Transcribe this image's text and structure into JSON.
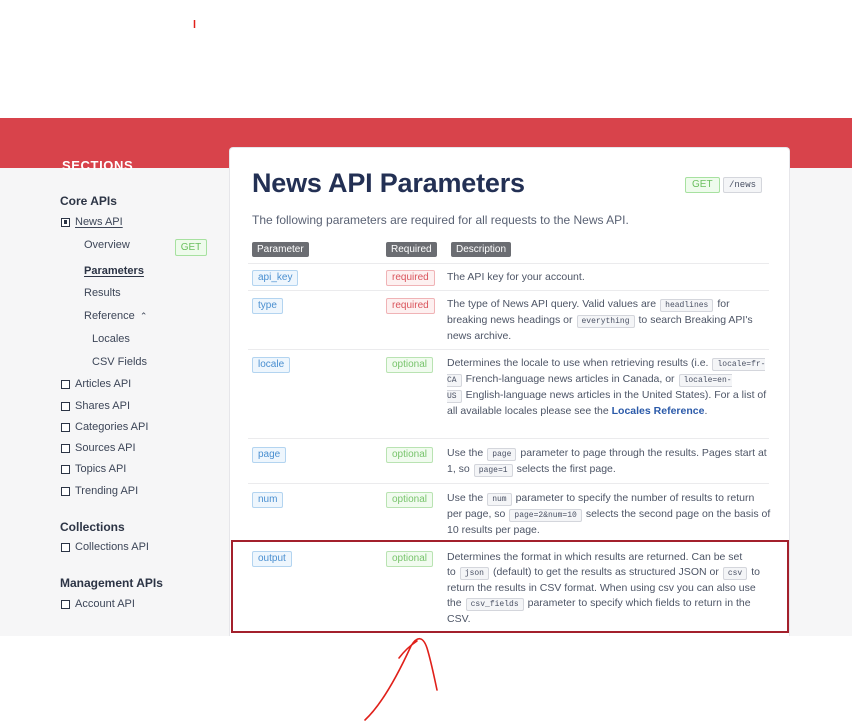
{
  "sidebar": {
    "title": "SECTIONS",
    "groups": {
      "core": {
        "title": "Core APIs",
        "items": [
          "News API",
          "Articles API",
          "Shares API",
          "Categories API",
          "Sources API",
          "Topics API",
          "Trending API"
        ]
      },
      "news_sub": {
        "overview": "Overview",
        "overview_method": "GET",
        "parameters": "Parameters",
        "results": "Results",
        "reference": "Reference",
        "locales": "Locales",
        "csv_fields": "CSV Fields"
      },
      "collections": {
        "title": "Collections",
        "items": [
          "Collections API"
        ]
      },
      "management": {
        "title": "Management APIs",
        "items": [
          "Account API"
        ]
      }
    }
  },
  "main": {
    "title": "News API Parameters",
    "method": "GET",
    "path": "/news",
    "subtitle": "The following parameters are required for all requests to the News API.",
    "headers": [
      "Parameter",
      "Required",
      "Description"
    ],
    "rows": [
      {
        "name": "api_key",
        "req": "required",
        "desc": [
          "The API key for your account."
        ]
      },
      {
        "name": "type",
        "req": "required",
        "desc": [
          "The type of News API query. Valid values are",
          "headlines",
          "for breaking news headings or",
          "everything",
          "to search Breaking API's news archive."
        ]
      },
      {
        "name": "locale",
        "req": "optional",
        "desc": [
          "Determines the locale to use when retrieving results (i.e.",
          "locale=fr-CA",
          "French-language news articles in Canada, or",
          "locale=en-US",
          "English-language news articles in the United States). For a list of all available locales please see the",
          "Locales Reference",
          "."
        ]
      },
      {
        "name": "page",
        "req": "optional",
        "desc": [
          "Use the",
          "page",
          "parameter to page through the results. Pages start at 1, so",
          "page=1",
          "selects the first page."
        ]
      },
      {
        "name": "num",
        "req": "optional",
        "desc": [
          "Use the",
          "num",
          "parameter to specify the number of results to return per page, so",
          "page=2&num=10",
          "selects the second page on the basis of 10 results per page."
        ]
      },
      {
        "name": "output",
        "req": "optional",
        "desc": [
          "Determines the format in which results are returned. Can be set to",
          "json",
          "(default) to get the results as structured JSON or",
          "csv",
          "to return the results in CSV format. When using csv you can also use the",
          "csv_fields",
          "parameter to specify which fields to return in the CSV."
        ]
      }
    ]
  },
  "colors": {
    "brand_red": "#d8434b",
    "highlight": "#a3202c",
    "annotation": "#e0201a"
  }
}
